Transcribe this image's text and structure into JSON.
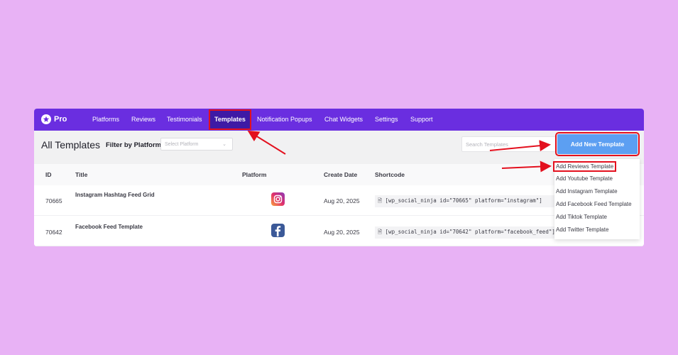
{
  "brand": {
    "name": "Pro"
  },
  "nav": {
    "items": [
      {
        "label": "Platforms"
      },
      {
        "label": "Reviews"
      },
      {
        "label": "Testimonials"
      },
      {
        "label": "Templates"
      },
      {
        "label": "Notification Popups"
      },
      {
        "label": "Chat Widgets"
      },
      {
        "label": "Settings"
      },
      {
        "label": "Support"
      }
    ],
    "active": "Templates"
  },
  "toolbar": {
    "title": "All Templates",
    "filter_label": "Filter by Platform",
    "filter_placeholder": "Select Platform",
    "search_placeholder": "Search Templates",
    "add_button": "Add New Template"
  },
  "table": {
    "columns": [
      "ID",
      "Title",
      "Platform",
      "Create Date",
      "Shortcode"
    ],
    "rows": [
      {
        "id": "70665",
        "title": "Instagram Hashtag Feed Grid",
        "platform_icon": "instagram-icon",
        "date": "Aug 20, 2025",
        "shortcode": "[wp_social_ninja id=\"70665\" platform=\"instagram\"]"
      },
      {
        "id": "70642",
        "title": "Facebook Feed Template",
        "platform_icon": "facebook-icon",
        "date": "Aug 20, 2025",
        "shortcode": "[wp_social_ninja id=\"70642\" platform=\"facebook_feed\"]"
      }
    ]
  },
  "dropdown": {
    "items": [
      "Add Reviews Template",
      "Add Youtube Template",
      "Add Instagram Template",
      "Add Facebook Feed Template",
      "Add Tiktok Template",
      "Add Twitter Template"
    ],
    "highlighted": "Add Reviews Template"
  },
  "colors": {
    "background": "#e8b2f5",
    "nav_bg": "#6a2ee0",
    "nav_active": "#3e1aa5",
    "button": "#5c9ff2",
    "highlight": "#e3101e"
  }
}
